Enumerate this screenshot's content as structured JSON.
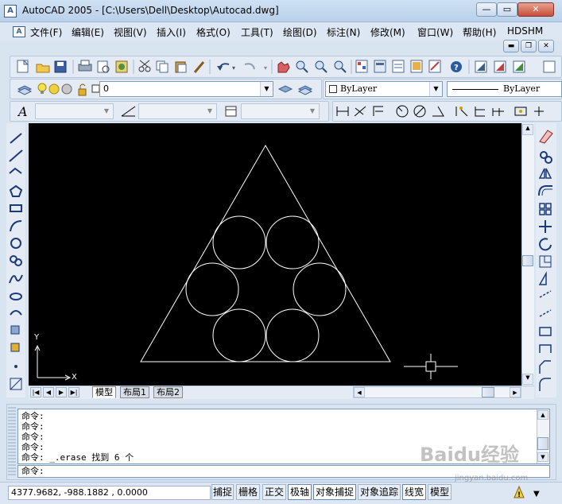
{
  "window": {
    "title": "AutoCAD 2005 - [C:\\Users\\Dell\\Desktop\\Autocad.dwg]",
    "app_icon": "A",
    "btn_min": "—",
    "btn_max": "▭",
    "btn_close": "✕"
  },
  "menu": [
    "文件(F)",
    "编辑(E)",
    "视图(V)",
    "插入(I)",
    "格式(O)",
    "工具(T)",
    "绘图(D)",
    "标注(N)",
    "修改(M)",
    "窗口(W)",
    "帮助(H)",
    "HDSHM"
  ],
  "layers": {
    "current_layer": "0",
    "color": "ByLayer",
    "linetype": "ByLayer"
  },
  "ucs": {
    "y_label": "Y",
    "x_label": "X"
  },
  "tabs": {
    "model": "模型",
    "layout1": "布局1",
    "layout2": "布局2"
  },
  "command": {
    "history": [
      "命令:",
      "命令:",
      "命令:",
      "命令:",
      "命令: _.erase 找到 6 个"
    ],
    "prompt": "命令:"
  },
  "status": {
    "coords": "4377.9682, -988.1882 , 0.0000",
    "toggles": [
      {
        "label": "捕捉",
        "on": false
      },
      {
        "label": "栅格",
        "on": false
      },
      {
        "label": "正交",
        "on": false
      },
      {
        "label": "极轴",
        "on": true
      },
      {
        "label": "对象捕捉",
        "on": true
      },
      {
        "label": "对象追踪",
        "on": false
      },
      {
        "label": "线宽",
        "on": true
      },
      {
        "label": "模型",
        "on": false
      }
    ]
  },
  "watermark": {
    "text": "Baidu经验",
    "sub": "jingyan.baidu.com"
  },
  "icons": [
    "new",
    "open",
    "save",
    "print",
    "preview",
    "publish",
    "cut",
    "copy",
    "paste",
    "matchprop",
    "undo",
    "redo",
    "pan",
    "zoom-realtime",
    "zoom-window",
    "zoom-previous",
    "properties",
    "design-center",
    "tool-palettes",
    "dbconnect",
    "markup",
    "help",
    "layer",
    "line",
    "xline",
    "polyline",
    "polygon",
    "rectangle",
    "arc",
    "circle",
    "revcloud",
    "spline",
    "ellipse",
    "ellipse-arc",
    "insert-block",
    "make-block",
    "point",
    "hatch",
    "region",
    "table",
    "mtext",
    "erase",
    "copy-object",
    "mirror",
    "offset",
    "array",
    "move",
    "rotate",
    "scale",
    "stretch",
    "trim",
    "extend",
    "break",
    "join",
    "chamfer",
    "fillet",
    "explode"
  ],
  "colors": {
    "canvas": "#000000",
    "drawing": "#ffffff",
    "chrome": "#d9e4f1"
  }
}
